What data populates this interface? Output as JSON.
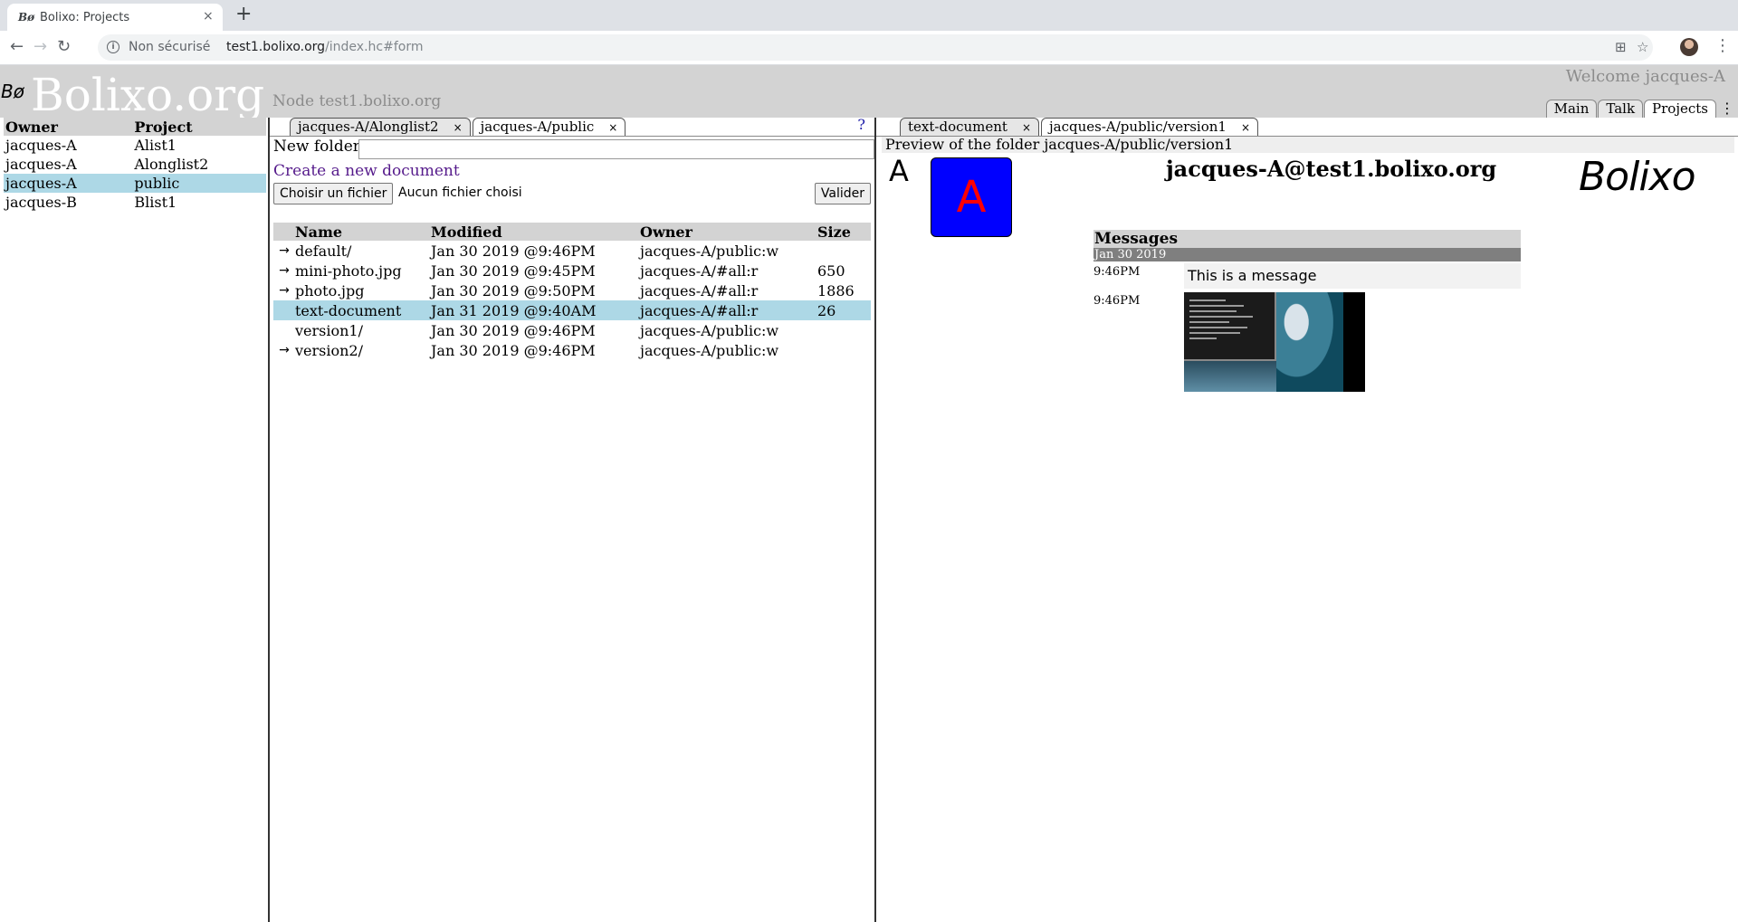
{
  "browser": {
    "tab_title": "Bolixo: Projects",
    "tab_favicon": "Bø",
    "tab_close": "×",
    "new_tab": "+",
    "security_label": "Non sécurisé",
    "url_host": "test1.bolixo.org",
    "url_path": "/index.hc#form",
    "icons": [
      "back-icon",
      "forward-icon",
      "reload-icon",
      "info-icon",
      "translate-icon",
      "star-icon",
      "profile-avatar",
      "menu-icon"
    ]
  },
  "header": {
    "small_logo": "Bø",
    "site_title": "Bolixo.org",
    "node_label": "Node test1.bolixo.org",
    "welcome": "Welcome jacques-A",
    "tabs": [
      {
        "label": "Main"
      },
      {
        "label": "Talk"
      },
      {
        "label": "Projects",
        "active": true
      }
    ],
    "menu_glyph": "⋮"
  },
  "projects": {
    "columns": [
      "Owner",
      "Project"
    ],
    "rows": [
      {
        "owner": "jacques-A",
        "project": "Alist1"
      },
      {
        "owner": "jacques-A",
        "project": "Alonglist2"
      },
      {
        "owner": "jacques-A",
        "project": "public",
        "selected": true
      },
      {
        "owner": "jacques-B",
        "project": "Blist1"
      }
    ]
  },
  "middle": {
    "tabs": [
      {
        "label": "jacques-A/Alonglist2",
        "close": "×"
      },
      {
        "label": "jacques-A/public",
        "close": "×",
        "active": true
      }
    ],
    "help": "?",
    "new_folder_label": "New folder",
    "new_folder_value": "",
    "create_link": "Create a new document",
    "choose_file": "Choisir un fichier",
    "no_file": "Aucun fichier choisi",
    "submit": "Valider",
    "columns": [
      "Name",
      "Modified",
      "Owner",
      "Size"
    ],
    "files": [
      {
        "arrow": "→",
        "name": "default/",
        "modified": "Jan 30 2019 @9:46PM",
        "owner": "jacques-A/public:w",
        "size": ""
      },
      {
        "arrow": "→",
        "name": "mini-photo.jpg",
        "modified": "Jan 30 2019 @9:45PM",
        "owner": "jacques-A/#all:r",
        "size": "650"
      },
      {
        "arrow": "→",
        "name": "photo.jpg",
        "modified": "Jan 30 2019 @9:50PM",
        "owner": "jacques-A/#all:r",
        "size": "1886"
      },
      {
        "arrow": "",
        "name": "text-document",
        "modified": "Jan 31 2019 @9:40AM",
        "owner": "jacques-A/#all:r",
        "size": "26",
        "selected": true
      },
      {
        "arrow": "",
        "name": "version1/",
        "modified": "Jan 30 2019 @9:46PM",
        "owner": "jacques-A/public:w",
        "size": ""
      },
      {
        "arrow": "→",
        "name": "version2/",
        "modified": "Jan 30 2019 @9:46PM",
        "owner": "jacques-A/public:w",
        "size": ""
      }
    ]
  },
  "right": {
    "tabs": [
      {
        "label": "text-document",
        "close": "×"
      },
      {
        "label": "jacques-A/public/version1",
        "close": "×",
        "active": true
      }
    ],
    "preview_title": "Preview of the folder jacques-A/public/version1",
    "initial": "A",
    "avatar_letter": "A",
    "user_address": "jacques-A@test1.bolixo.org",
    "logo_text": "Bolixo",
    "messages": {
      "header": "Messages",
      "date": "Jan 30 2019",
      "items": [
        {
          "time": "9:46PM",
          "text": "This is a message"
        },
        {
          "time": "9:46PM",
          "image": "screenshot-thumbnail"
        }
      ]
    }
  },
  "colors": {
    "header_bg": "#d3d3d3",
    "selected_row": "#add8e6",
    "avatar_bg": "#0000ff",
    "avatar_fg": "#ff0000",
    "link": "#551a8b"
  }
}
